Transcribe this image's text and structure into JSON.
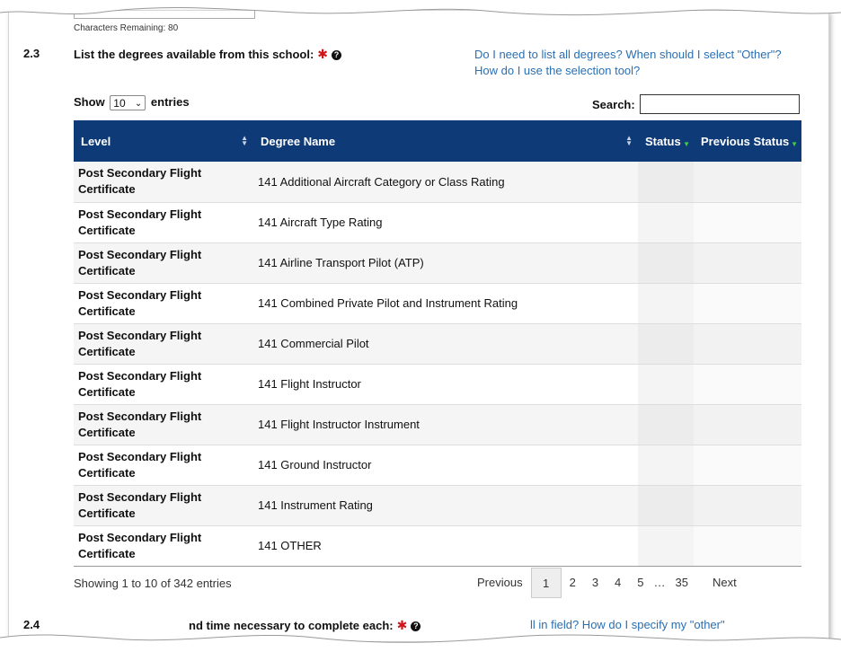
{
  "top": {
    "chars_remaining": "Characters Remaining: 80"
  },
  "section": {
    "number": "2.3",
    "title": "List the degrees available from this school:",
    "help_links": [
      "Do I need to list all degrees? When should I select \"Other\"?",
      "How do I use the selection tool?"
    ]
  },
  "controls": {
    "show_label": "Show",
    "entries_value": "10",
    "entries_label": "entries",
    "search_label": "Search:",
    "search_value": ""
  },
  "table": {
    "columns": [
      "Level",
      "Degree Name",
      "Status",
      "Previous Status"
    ],
    "rows": [
      {
        "level": "Post Secondary Flight Certificate",
        "degree": "141 Additional Aircraft Category or Class Rating",
        "status": "",
        "prev": ""
      },
      {
        "level": "Post Secondary Flight Certificate",
        "degree": "141 Aircraft Type Rating",
        "status": "",
        "prev": ""
      },
      {
        "level": "Post Secondary Flight Certificate",
        "degree": "141 Airline Transport Pilot (ATP)",
        "status": "",
        "prev": ""
      },
      {
        "level": "Post Secondary Flight Certificate",
        "degree": "141 Combined Private Pilot and Instrument Rating",
        "status": "",
        "prev": ""
      },
      {
        "level": "Post Secondary Flight Certificate",
        "degree": "141 Commercial Pilot",
        "status": "",
        "prev": ""
      },
      {
        "level": "Post Secondary Flight Certificate",
        "degree": "141 Flight Instructor",
        "status": "",
        "prev": ""
      },
      {
        "level": "Post Secondary Flight Certificate",
        "degree": "141 Flight Instructor Instrument",
        "status": "",
        "prev": ""
      },
      {
        "level": "Post Secondary Flight Certificate",
        "degree": "141 Ground Instructor",
        "status": "",
        "prev": ""
      },
      {
        "level": "Post Secondary Flight Certificate",
        "degree": "141 Instrument Rating",
        "status": "",
        "prev": ""
      },
      {
        "level": "Post Secondary Flight Certificate",
        "degree": "141 OTHER",
        "status": "",
        "prev": ""
      }
    ]
  },
  "footer": {
    "info": "Showing 1 to 10 of 342 entries",
    "pager": {
      "previous": "Previous",
      "pages": [
        "1",
        "2",
        "3",
        "4",
        "5",
        "…",
        "35"
      ],
      "current": "1",
      "next": "Next"
    }
  },
  "next_section": {
    "number": "2.4",
    "title_fragment": "nd time necessary to complete each:",
    "help_fragment": "ll in field? How do I specify my \"other\""
  },
  "colors": {
    "header_bg": "#0f3a78",
    "link": "#2a6fb2",
    "required": "#d0161a",
    "sort_active": "#3ecf4a"
  },
  "icons": {
    "required": "asterisk-icon",
    "help": "question-circle-icon",
    "sort": "sort-icon",
    "sort_desc": "sort-desc-icon",
    "dropdown": "chevron-down-icon"
  }
}
